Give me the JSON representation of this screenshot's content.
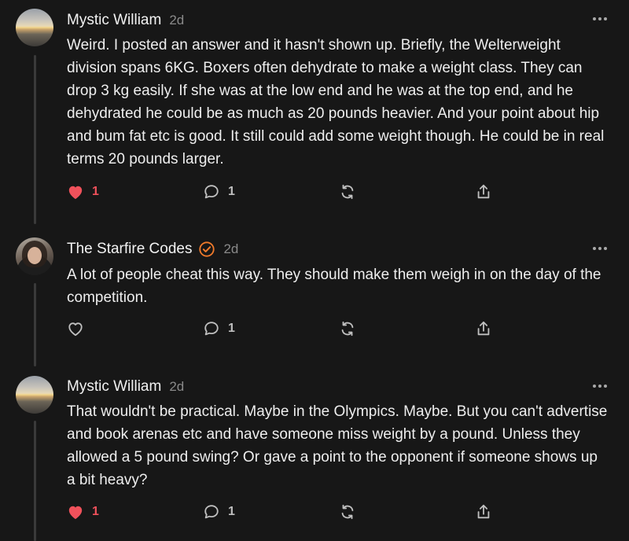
{
  "comments": [
    {
      "author": "Mystic William",
      "time": "2d",
      "verified": false,
      "avatar": "sunset-avatar",
      "text": "Weird. I posted an answer and it hasn't shown up. Briefly, the Welterweight division spans 6KG. Boxers often dehydrate to make a weight class. They can drop 3 kg easily. If she was at the low end and he was at the top end, and he dehydrated he could be as much as 20 pounds heavier. And your point about hip and bum fat etc is good. It still could add some weight though. He could be in real terms 20 pounds larger.",
      "likes": "1",
      "liked": true,
      "replies": "1"
    },
    {
      "author": "The Starfire Codes",
      "time": "2d",
      "verified": true,
      "avatar": "portrait-avatar",
      "text": "A lot of people cheat this way. They should make them weigh in on the day of the competition.",
      "likes": "",
      "liked": false,
      "replies": "1"
    },
    {
      "author": "Mystic William",
      "time": "2d",
      "verified": false,
      "avatar": "sunset-avatar",
      "text": "That wouldn't be practical. Maybe in the Olympics. Maybe. But you can't advertise and book arenas etc and have someone miss weight by a pound. Unless they allowed a 5 pound swing? Or gave a point to the opponent if someone shows up a bit heavy?",
      "likes": "1",
      "liked": true,
      "replies": "1"
    }
  ],
  "icons": {
    "like": "heart-icon",
    "reply": "speech-bubble-icon",
    "restack": "restack-icon",
    "share": "share-icon",
    "more": "more-options-icon",
    "verified": "verified-badge-icon"
  },
  "colors": {
    "background": "#171717",
    "liked": "#f0515b",
    "verified": "#f07a2b",
    "muted": "#8a8a8a"
  }
}
